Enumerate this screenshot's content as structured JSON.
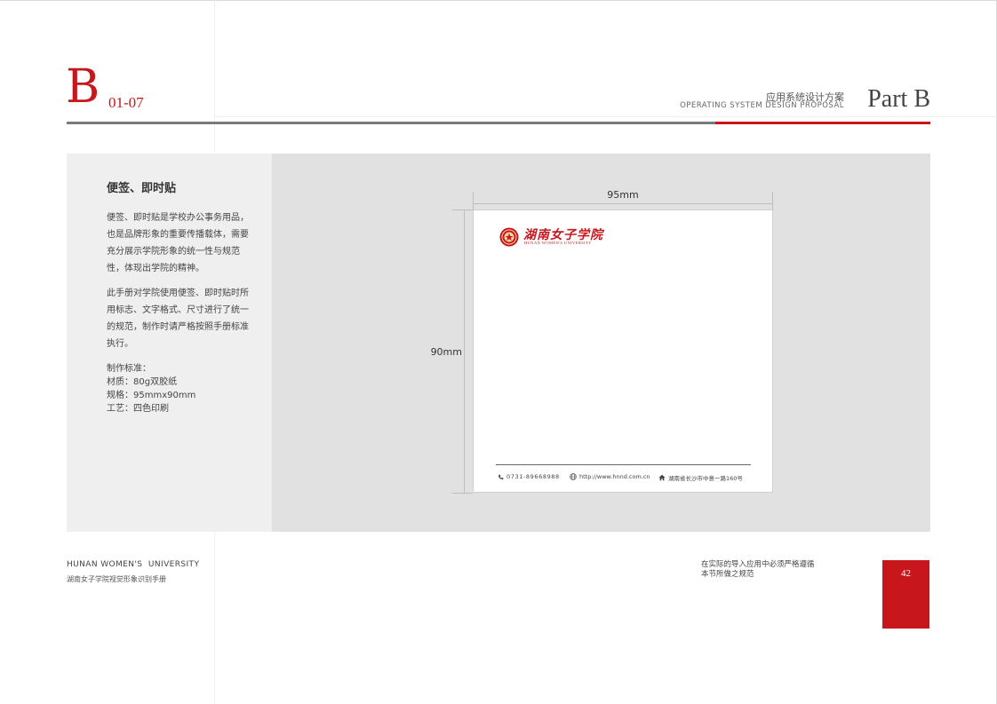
{
  "header": {
    "section_letter": "B",
    "section_number": "01-07",
    "title_cn": "应用系统设计方案",
    "title_en": "OPERATING SYSTEM DESIGN PROPOSAL",
    "part_label": "Part B"
  },
  "content": {
    "title": "便签、即时贴",
    "paragraph_1": "便签、即时贴是学校办公事务用品，也是品牌形象的重要传播载体，需要充分展示学院形象的统一性与规范性，体现出学院的精神。",
    "paragraph_2": "此手册对学院使用便签、即时贴时所用标志、文字格式、尺寸进行了统一的规范，制作时请严格按照手册标准执行。",
    "specs": [
      "制作标准：",
      "材质：80g双胶纸",
      "规格：95mmx90mm",
      "工艺：四色印刷"
    ]
  },
  "mockup": {
    "width_label": "95mm",
    "height_label": "90mm",
    "logo_cn": "湖南女子学院",
    "logo_en": "HUNAN WOMEN'S UNIVERSITY",
    "phone": "0731-89668988",
    "website": "http://www.hnnd.com.cn",
    "address": "湖南省长沙市中意一路160号",
    "icons": {
      "phone": "phone-icon",
      "website": "globe-icon",
      "address": "home-icon"
    }
  },
  "footer": {
    "university_en": "HUNAN WOMEN'S  UNIVERSITY",
    "manual_cn": "湖南女子学院视觉形象识别手册",
    "note_line_1": "在实际的导入应用中必须严格遵循",
    "note_line_2": "本节所做之规范",
    "page_number": "42"
  },
  "colors": {
    "accent": "#c8161d",
    "panel_light": "#efefef",
    "panel_dark": "#e1e1e1",
    "rule_gray": "#7a7a7a"
  }
}
